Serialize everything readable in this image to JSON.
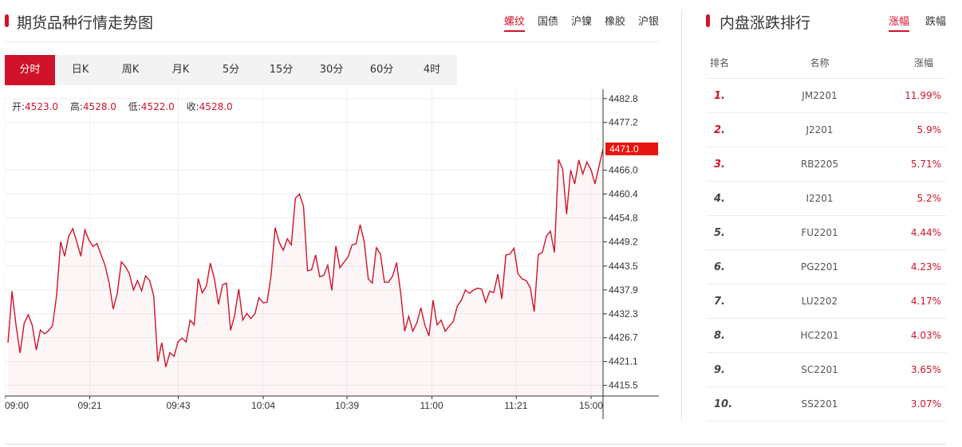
{
  "left_panel": {
    "title": "期货品种行情走势图",
    "product_tabs": [
      {
        "label": "螺纹",
        "active": true
      },
      {
        "label": "国债",
        "active": false
      },
      {
        "label": "沪镍",
        "active": false
      },
      {
        "label": "橡胶",
        "active": false
      },
      {
        "label": "沪银",
        "active": false
      }
    ],
    "periods": [
      {
        "label": "分时",
        "active": true
      },
      {
        "label": "日K",
        "active": false
      },
      {
        "label": "周K",
        "active": false
      },
      {
        "label": "月K",
        "active": false
      },
      {
        "label": "5分",
        "active": false
      },
      {
        "label": "15分",
        "active": false
      },
      {
        "label": "30分",
        "active": false
      },
      {
        "label": "60分",
        "active": false
      },
      {
        "label": "4时",
        "active": false
      }
    ],
    "ohlc": {
      "open_label": "开:",
      "open": "4523.0",
      "high_label": "高:",
      "high": "4528.0",
      "low_label": "低:",
      "low": "4522.0",
      "close_label": "收:",
      "close": "4528.0"
    }
  },
  "chart_data": {
    "type": "line",
    "title": "",
    "xlabel": "",
    "ylabel": "",
    "y_ticks": [
      "4482.8",
      "4477.2",
      "4466.0",
      "4460.4",
      "4454.8",
      "4449.2",
      "4443.5",
      "4437.9",
      "4432.3",
      "4426.7",
      "4421.1",
      "4415.5"
    ],
    "ylim": [
      4413.0,
      4485.0
    ],
    "x_tick_labels": [
      "09:00",
      "09:21",
      "09:43",
      "10:04",
      "10:39",
      "11:00",
      "11:21",
      "15:00"
    ],
    "current_price_label": "4471.0",
    "line_color": "#d0132a",
    "series": [
      {
        "values": [
          4425.5,
          4437.6,
          4429.6,
          4423.1,
          4430.1,
          4432.1,
          4429.6,
          4423.8,
          4428.5,
          4427.6,
          4428.3,
          4429.5,
          4436.5,
          4449.2,
          4445.8,
          4450.5,
          4452.3,
          4449.2,
          4445.8,
          4452.0,
          4449.6,
          4448.1,
          4448.8,
          4446.2,
          4443.6,
          4439.5,
          4433.4,
          4437.1,
          4444.5,
          4443.4,
          4441.7,
          4437.9,
          4440.1,
          4437.7,
          4441.2,
          4440.1,
          4436.5,
          4421.1,
          4425.5,
          4419.8,
          4423.2,
          4422.3,
          4425.7,
          4426.6,
          4425.7,
          4430.8,
          4429.7,
          4440.6,
          4437.2,
          4438.8,
          4444.2,
          4440.5,
          4434.5,
          4439.1,
          4439.5,
          4428.4,
          4432.0,
          4438.1,
          4430.8,
          4432.4,
          4431.2,
          4432.3,
          4436.1,
          4434.9,
          4435.0,
          4441.4,
          4452.5,
          4449.1,
          4447.2,
          4449.9,
          4448.5,
          4459.4,
          4460.4,
          4457.5,
          4442.4,
          4442.6,
          4446.1,
          4441.0,
          4441.3,
          4443.7,
          4437.8,
          4448.2,
          4443.1,
          4444.4,
          4445.6,
          4448.5,
          4448.7,
          4453.2,
          4449.2,
          4440.5,
          4439.5,
          4447.8,
          4446.3,
          4439.7,
          4439.7,
          4441.1,
          4444.3,
          4437.2,
          4428.2,
          4431.7,
          4428.2,
          4430.2,
          4433.7,
          4429.6,
          4427.1,
          4435.5,
          4429.7,
          4430.8,
          4428.2,
          4429.4,
          4430.5,
          4434.1,
          4435.5,
          4437.9,
          4437.1,
          4437.9,
          4438.3,
          4438.1,
          4435.0,
          4437.6,
          4437.3,
          4441.6,
          4435.8,
          4446.1,
          4446.3,
          4447.7,
          4441.7,
          4440.5,
          4440.1,
          4438.5,
          4432.8,
          4446.2,
          4446.7,
          4450.5,
          4451.7,
          4446.7,
          4468.5,
          4466.3,
          4455.7,
          4466.0,
          4462.8,
          4468.4,
          4465.1,
          4467.9,
          4466.2,
          4462.8,
          4466.9,
          4471.0
        ]
      }
    ]
  },
  "right_panel": {
    "title": "内盘涨跌排行",
    "tabs": [
      {
        "label": "涨幅",
        "active": true
      },
      {
        "label": "跌幅",
        "active": false
      }
    ],
    "columns": [
      "排名",
      "名称",
      "涨幅"
    ],
    "rows": [
      {
        "rank": "1.",
        "name": "JM2201",
        "change": "11.99%"
      },
      {
        "rank": "2.",
        "name": "J2201",
        "change": "5.9%"
      },
      {
        "rank": "3.",
        "name": "RB2205",
        "change": "5.71%"
      },
      {
        "rank": "4.",
        "name": "I2201",
        "change": "5.2%"
      },
      {
        "rank": "5.",
        "name": "FU2201",
        "change": "4.44%"
      },
      {
        "rank": "6.",
        "name": "PG2201",
        "change": "4.23%"
      },
      {
        "rank": "7.",
        "name": "LU2202",
        "change": "4.17%"
      },
      {
        "rank": "8.",
        "name": "HC2201",
        "change": "4.03%"
      },
      {
        "rank": "9.",
        "name": "SC2201",
        "change": "3.65%"
      },
      {
        "rank": "10.",
        "name": "SS2201",
        "change": "3.07%"
      }
    ]
  }
}
